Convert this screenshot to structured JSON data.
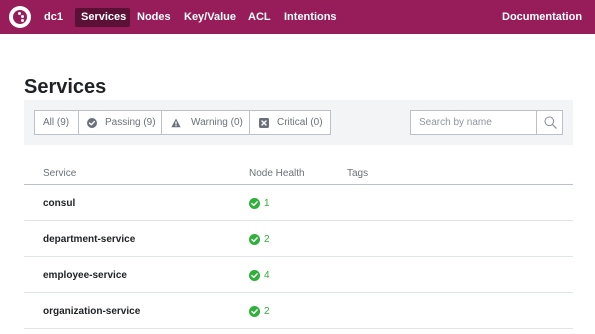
{
  "nav": {
    "datacenter": "dc1",
    "items": [
      {
        "label": "Services",
        "active": true
      },
      {
        "label": "Nodes"
      },
      {
        "label": "Key/Value"
      },
      {
        "label": "ACL"
      },
      {
        "label": "Intentions"
      }
    ],
    "documentation": "Documentation",
    "brand_color": "#961d59"
  },
  "page": {
    "title": "Services"
  },
  "filters": [
    {
      "label": "All (9)",
      "icon": null,
      "active": true
    },
    {
      "label": "Passing (9)",
      "icon": "check-circle-icon"
    },
    {
      "label": "Warning (0)",
      "icon": "warning-triangle-icon"
    },
    {
      "label": "Critical (0)",
      "icon": "critical-x-icon"
    }
  ],
  "search": {
    "placeholder": "Search by name",
    "value": ""
  },
  "table": {
    "columns": [
      "Service",
      "Node Health",
      "Tags"
    ],
    "rows": [
      {
        "name": "consul",
        "health": "1",
        "tags": ""
      },
      {
        "name": "department-service",
        "health": "2",
        "tags": ""
      },
      {
        "name": "employee-service",
        "health": "4",
        "tags": ""
      },
      {
        "name": "organization-service",
        "health": "2",
        "tags": ""
      }
    ]
  },
  "colors": {
    "passing": "#2eb039"
  }
}
